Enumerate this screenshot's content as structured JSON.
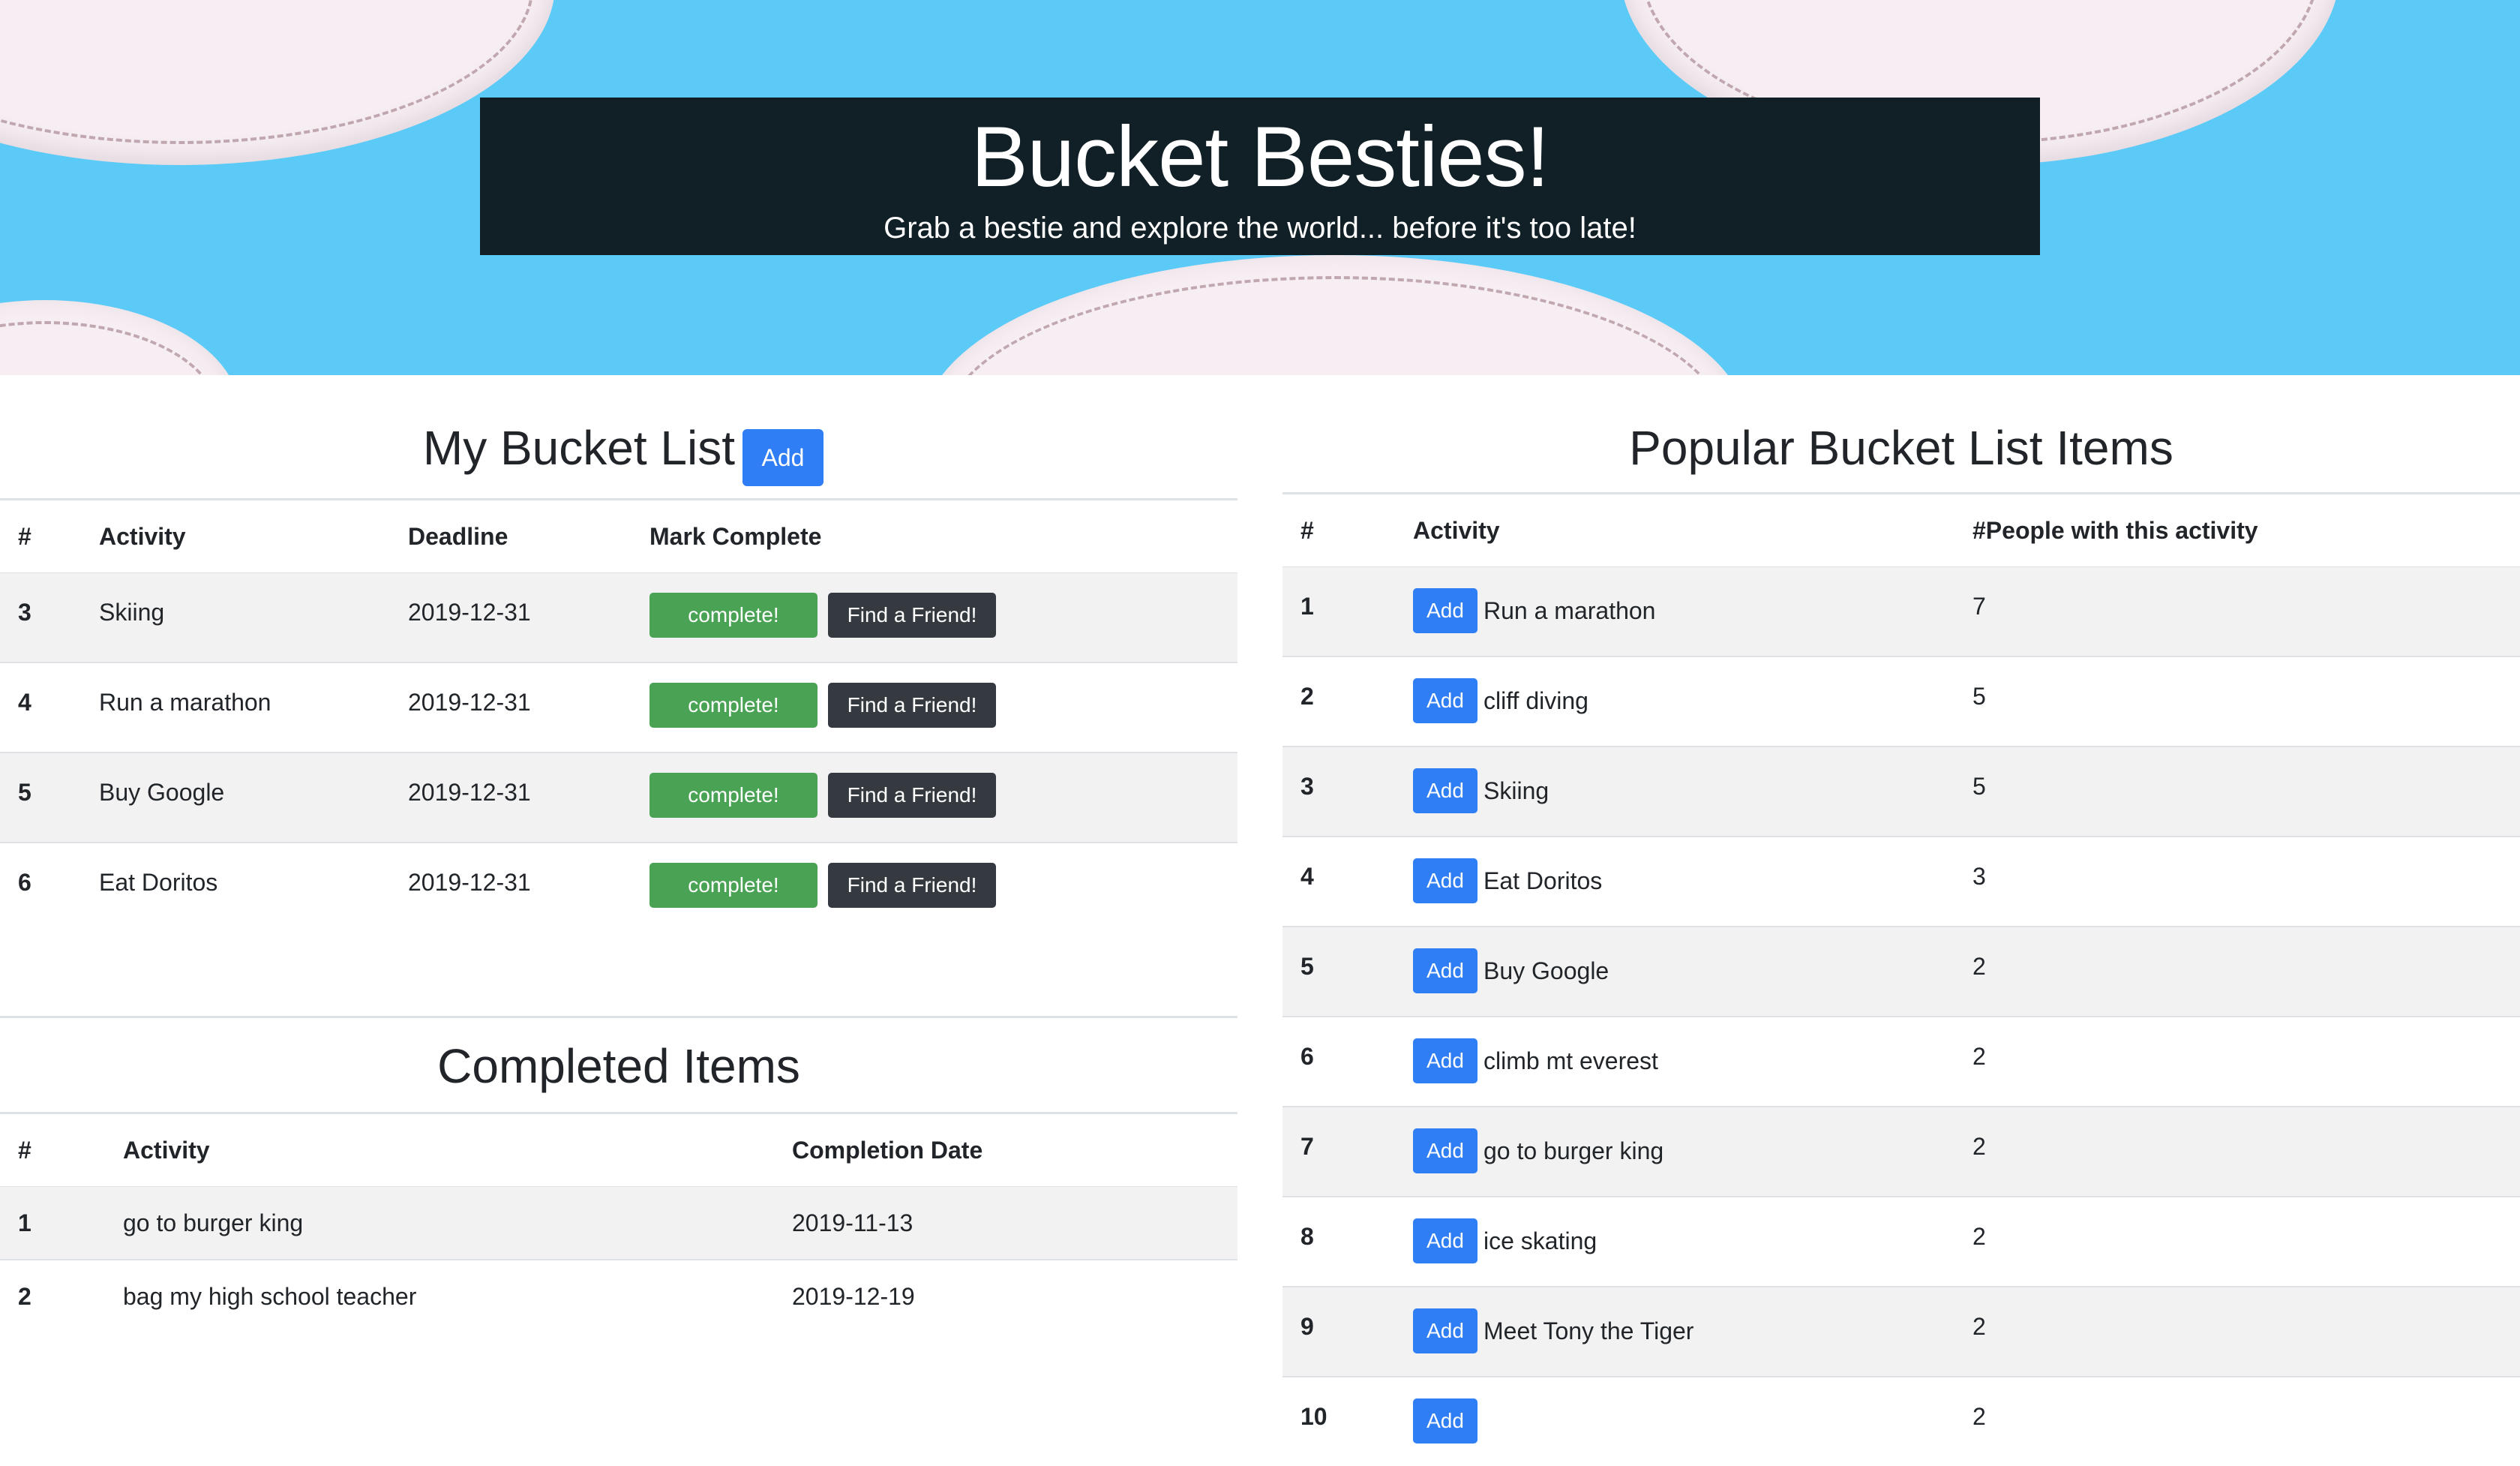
{
  "hero": {
    "title": "Bucket Besties!",
    "subtitle": "Grab a bestie and explore the world... before it's too late!"
  },
  "my_list": {
    "title": "My Bucket List",
    "add_label": "Add",
    "headers": [
      "#",
      "Activity",
      "Deadline",
      "Mark Complete"
    ],
    "complete_label": "complete!",
    "friend_label": "Find a Friend!",
    "rows": [
      {
        "num": "3",
        "activity": "Skiing",
        "deadline": "2019-12-31"
      },
      {
        "num": "4",
        "activity": "Run a marathon",
        "deadline": "2019-12-31"
      },
      {
        "num": "5",
        "activity": "Buy Google",
        "deadline": "2019-12-31"
      },
      {
        "num": "6",
        "activity": "Eat Doritos",
        "deadline": "2019-12-31"
      }
    ]
  },
  "completed": {
    "title": "Completed Items",
    "headers": [
      "#",
      "Activity",
      "Completion Date"
    ],
    "rows": [
      {
        "num": "1",
        "activity": "go to burger king",
        "date": "2019-11-13"
      },
      {
        "num": "2",
        "activity": "bag my high school teacher",
        "date": "2019-12-19"
      }
    ]
  },
  "popular": {
    "title": "Popular Bucket List Items",
    "headers": [
      "#",
      "Activity",
      "#People with this activity"
    ],
    "add_label": "Add",
    "rows": [
      {
        "num": "1",
        "activity": "Run a marathon",
        "people": "7"
      },
      {
        "num": "2",
        "activity": "cliff diving",
        "people": "5"
      },
      {
        "num": "3",
        "activity": "Skiing",
        "people": "5"
      },
      {
        "num": "4",
        "activity": "Eat Doritos",
        "people": "3"
      },
      {
        "num": "5",
        "activity": "Buy Google",
        "people": "2"
      },
      {
        "num": "6",
        "activity": "climb mt everest",
        "people": "2"
      },
      {
        "num": "7",
        "activity": "go to burger king",
        "people": "2"
      },
      {
        "num": "8",
        "activity": "ice skating",
        "people": "2"
      },
      {
        "num": "9",
        "activity": "Meet Tony the Tiger",
        "people": "2"
      },
      {
        "num": "10",
        "activity": "",
        "people": "2"
      }
    ]
  }
}
